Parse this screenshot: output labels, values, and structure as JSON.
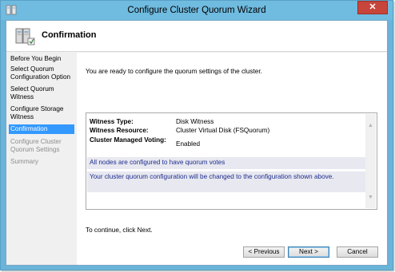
{
  "window": {
    "title": "Configure Cluster Quorum Wizard",
    "close_glyph": "✕"
  },
  "header": {
    "title": "Confirmation",
    "icon": "cluster-wizard-icon"
  },
  "nav": {
    "items": [
      {
        "label": "Before You Begin",
        "state": "normal"
      },
      {
        "label": "Select Quorum Configuration Option",
        "state": "normal"
      },
      {
        "label": "Select Quorum Witness",
        "state": "normal"
      },
      {
        "label": "Configure Storage Witness",
        "state": "normal"
      },
      {
        "label": "Confirmation",
        "state": "active"
      },
      {
        "label": "Configure Cluster Quorum Settings",
        "state": "disabled"
      },
      {
        "label": "Summary",
        "state": "disabled"
      }
    ]
  },
  "main": {
    "intro": "You are ready to configure the quorum settings of the cluster.",
    "summary": {
      "rows": [
        {
          "key": "Witness Type:",
          "value": "Disk Witness"
        },
        {
          "key": "Witness Resource:",
          "value": "Cluster Virtual Disk (FSQuorum)"
        },
        {
          "key": "Cluster Managed Voting:",
          "value": "Enabled"
        }
      ],
      "note_votes": "All nodes are configured to have quorum votes",
      "note_change": "Your cluster quorum configuration will be changed to the configuration shown above."
    },
    "continue_text": "To continue, click Next."
  },
  "buttons": {
    "previous": "< Previous",
    "next": "Next >",
    "cancel": "Cancel"
  },
  "colors": {
    "titlebar": "#70bbe0",
    "accent_selected": "#3399ff",
    "note_text": "#1c2d8c",
    "close": "#c7453a"
  }
}
